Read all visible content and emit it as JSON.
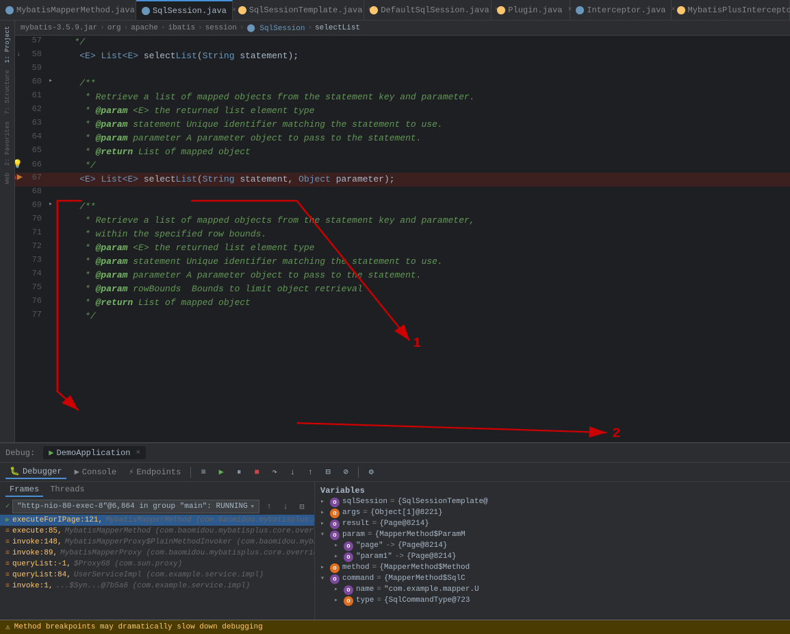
{
  "tabs": [
    {
      "id": "mybatis-mapper",
      "label": "MybatisMapperMethod.java",
      "type": "interface",
      "active": false,
      "closeable": true
    },
    {
      "id": "sql-session",
      "label": "SqlSession.java",
      "type": "interface",
      "active": true,
      "closeable": true
    },
    {
      "id": "sql-session-template",
      "label": "SqlSessionTemplate.java",
      "type": "class",
      "active": false,
      "closeable": true
    },
    {
      "id": "default-sql-session",
      "label": "DefaultSqlSession.java",
      "type": "class",
      "active": false,
      "closeable": true
    },
    {
      "id": "plugin",
      "label": "Plugin.java",
      "type": "class",
      "active": false,
      "closeable": true
    },
    {
      "id": "interceptor",
      "label": "Interceptor.java",
      "type": "interface",
      "active": false,
      "closeable": true
    },
    {
      "id": "mybatis-plus-interceptor",
      "label": "MybatisPlusInterceptor",
      "type": "class",
      "active": false,
      "closeable": false
    }
  ],
  "breadcrumb": {
    "items": [
      "mybatis-3.5.9.jar",
      "org",
      "apache",
      "ibatis",
      "session",
      "SqlSession",
      "selectList"
    ]
  },
  "code": {
    "lines": [
      {
        "num": 57,
        "gutter_icons": [],
        "fold": false,
        "content": "   */"
      },
      {
        "num": 58,
        "gutter_icons": [
          "return"
        ],
        "fold": false,
        "content": "    <E> List<E> selectList(String statement);"
      },
      {
        "num": 59,
        "gutter_icons": [],
        "fold": false,
        "content": ""
      },
      {
        "num": 60,
        "gutter_icons": [],
        "fold": true,
        "content": "    /**"
      },
      {
        "num": 61,
        "gutter_icons": [],
        "fold": false,
        "content": "     * Retrieve a list of mapped objects from the statement key and parameter."
      },
      {
        "num": 62,
        "gutter_icons": [],
        "fold": false,
        "content": "     * @param <E> the returned list element type"
      },
      {
        "num": 63,
        "gutter_icons": [],
        "fold": false,
        "content": "     * @param statement Unique identifier matching the statement to use."
      },
      {
        "num": 64,
        "gutter_icons": [],
        "fold": false,
        "content": "     * @param parameter A parameter object to pass to the statement."
      },
      {
        "num": 65,
        "gutter_icons": [],
        "fold": false,
        "content": "     * @return List of mapped object"
      },
      {
        "num": 66,
        "gutter_icons": [
          "bulb"
        ],
        "fold": false,
        "content": "     */"
      },
      {
        "num": 67,
        "gutter_icons": [
          "breakpoint",
          "arrow"
        ],
        "fold": false,
        "content": "    <E> List<E> selectList(String statement, Object parameter);",
        "highlighted": true
      },
      {
        "num": 68,
        "gutter_icons": [],
        "fold": false,
        "content": ""
      },
      {
        "num": 69,
        "gutter_icons": [],
        "fold": true,
        "content": "    /**"
      },
      {
        "num": 70,
        "gutter_icons": [],
        "fold": false,
        "content": "     * Retrieve a list of mapped objects from the statement key and parameter,"
      },
      {
        "num": 71,
        "gutter_icons": [],
        "fold": false,
        "content": "     * within the specified row bounds."
      },
      {
        "num": 72,
        "gutter_icons": [],
        "fold": false,
        "content": "     * @param <E> the returned list element type"
      },
      {
        "num": 73,
        "gutter_icons": [],
        "fold": false,
        "content": "     * @param statement Unique identifier matching the statement to use."
      },
      {
        "num": 74,
        "gutter_icons": [],
        "fold": false,
        "content": "     * @param parameter A parameter object to pass to the statement."
      },
      {
        "num": 75,
        "gutter_icons": [],
        "fold": false,
        "content": "     * @param rowBounds  Bounds to limit object retrieval"
      },
      {
        "num": 76,
        "gutter_icons": [],
        "fold": false,
        "content": "     * @return List of mapped object"
      },
      {
        "num": 77,
        "gutter_icons": [],
        "fold": false,
        "content": "     */"
      }
    ]
  },
  "debug": {
    "session_label": "Debug:",
    "session_name": "DemoApplication",
    "tabs": [
      {
        "id": "debugger",
        "label": "Debugger",
        "icon": "🐛",
        "active": true
      },
      {
        "id": "console",
        "label": "Console",
        "icon": "▶",
        "active": false
      },
      {
        "id": "endpoints",
        "label": "Endpoints",
        "icon": "⚡",
        "active": false
      }
    ],
    "frames_tabs": [
      {
        "id": "frames",
        "label": "Frames",
        "active": true
      },
      {
        "id": "threads",
        "label": "Threads",
        "active": false
      }
    ],
    "thread_text": "\"http-nio-80-exec-8\"@6,864 in group \"main\": RUNNING",
    "frames": [
      {
        "id": 1,
        "icon": "green",
        "name": "executeForIPage:121",
        "location": "MybatisMapperMethod (com.baomidou.mybatisplus.core.override)",
        "selected": true
      },
      {
        "id": 2,
        "icon": "orange",
        "name": "execute:85",
        "location": "MybatisMapperMethod (com.baomidou.mybatisplus.core.override)",
        "selected": false
      },
      {
        "id": 3,
        "icon": "orange",
        "name": "invoke:148",
        "location": "MybatisMapperProxy$PlainMethodInvoker (com.baomidou.mybatisplus.core.override)",
        "selected": false
      },
      {
        "id": 4,
        "icon": "orange",
        "name": "invoke:89",
        "location": "MybatisMapperProxy (com.baomidou.mybatisplus.core.override)",
        "selected": false
      },
      {
        "id": 5,
        "icon": "orange",
        "name": "queryList:-1",
        "location": "$Proxy68 (com.sun.proxy)",
        "selected": false
      },
      {
        "id": 6,
        "icon": "orange",
        "name": "queryList:84",
        "location": "UserServiceImpl (com.example.service.impl)",
        "selected": false
      },
      {
        "id": 7,
        "icon": "orange",
        "name": "invoke:1",
        "location": "...$Syn...@7b5a6 (com.example.service.impl)",
        "selected": false
      }
    ],
    "variables_header": "Variables",
    "variables": [
      {
        "id": "sqlSession",
        "expand": false,
        "icon": "purple",
        "icon_label": "o",
        "name": "sqlSession",
        "eq": "=",
        "value": "{SqlSessionTemplate@",
        "indent": 0
      },
      {
        "id": "args",
        "expand": false,
        "icon": "orange",
        "icon_label": "o",
        "name": "args",
        "eq": "=",
        "value": "{Object[1]@8221}",
        "indent": 0
      },
      {
        "id": "result",
        "expand": false,
        "icon": "purple",
        "icon_label": "o",
        "name": "result",
        "eq": "=",
        "value": "{Page@8214}",
        "indent": 0
      },
      {
        "id": "param",
        "expand": true,
        "icon": "purple",
        "icon_label": "o",
        "name": "param",
        "eq": "=",
        "value": "{MapperMethod$ParamM",
        "indent": 0
      },
      {
        "id": "param-page",
        "expand": false,
        "icon": "purple",
        "icon_label": "o",
        "name": "\"page\"",
        "eq": "->",
        "value": "{Page@8214}",
        "indent": 1
      },
      {
        "id": "param-param1",
        "expand": false,
        "icon": "purple",
        "icon_label": "o",
        "name": "\"param1\"",
        "eq": "->",
        "value": "{Page@8214}",
        "indent": 1
      },
      {
        "id": "method",
        "expand": false,
        "icon": "orange",
        "icon_label": "o",
        "name": "method",
        "eq": "=",
        "value": "{MapperMethod$Method",
        "indent": 0
      },
      {
        "id": "command",
        "expand": true,
        "icon": "purple",
        "icon_label": "o",
        "name": "command",
        "eq": "=",
        "value": "{MapperMethod$SqlC",
        "indent": 0
      },
      {
        "id": "command-name",
        "expand": false,
        "icon": "purple",
        "icon_label": "o",
        "name": "name",
        "eq": "=",
        "value": "\"com.example.mapper.U",
        "indent": 1
      },
      {
        "id": "command-type",
        "expand": false,
        "icon": "orange",
        "icon_label": "o",
        "name": "type",
        "eq": "=",
        "value": "{SqlCommandType@723",
        "indent": 1
      }
    ]
  },
  "warning": {
    "text": "Method breakpoints may dramatically slow down debugging"
  },
  "annotations": [
    {
      "id": "1",
      "value": "1"
    },
    {
      "id": "2",
      "value": "2"
    }
  ],
  "icons": {
    "close": "×",
    "fold_open": "▾",
    "fold_closed": "▸",
    "chevron_down": "▾",
    "chevron_right": "▸",
    "run": "▶",
    "stop": "■",
    "pause": "⏸",
    "step_over": "↷",
    "step_into": "↓",
    "step_out": "↑",
    "resume": "▶",
    "mute": "⊘",
    "frames_icon": "≡",
    "up_arrow": "↑",
    "down_arrow": "↓",
    "filter": "⊟"
  }
}
